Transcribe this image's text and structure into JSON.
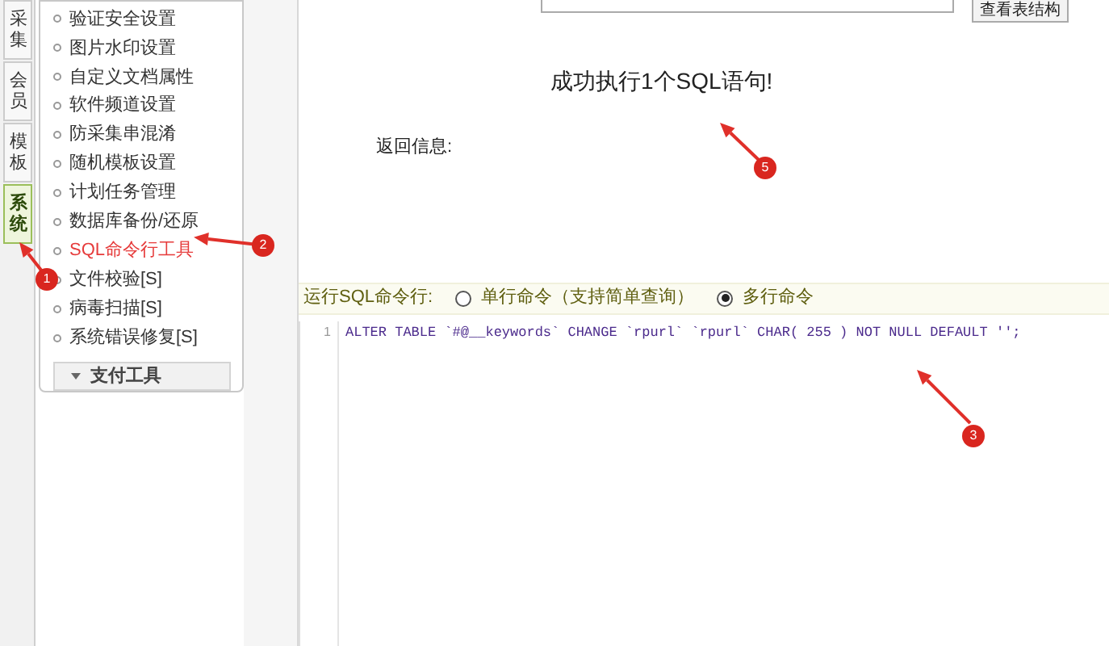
{
  "side_tabs": [
    {
      "label": "采集",
      "selected": false
    },
    {
      "label": "会员",
      "selected": false
    },
    {
      "label": "模板",
      "selected": false
    },
    {
      "label": "系统",
      "selected": true
    }
  ],
  "menu": {
    "items": [
      {
        "label": "验证安全设置",
        "selected": false
      },
      {
        "label": "图片水印设置",
        "selected": false
      },
      {
        "label": "自定义文档属性",
        "selected": false
      },
      {
        "label": "软件频道设置",
        "selected": false
      },
      {
        "label": "防采集串混淆",
        "selected": false
      },
      {
        "label": "随机模板设置",
        "selected": false
      },
      {
        "label": "计划任务管理",
        "selected": false
      },
      {
        "label": "数据库备份/还原",
        "selected": false
      },
      {
        "label": "SQL命令行工具",
        "selected": true
      },
      {
        "label": "文件校验[S]",
        "selected": false
      },
      {
        "label": "病毒扫描[S]",
        "selected": false
      },
      {
        "label": "系统错误修复[S]",
        "selected": false
      }
    ],
    "group_button": "支付工具"
  },
  "toolbar": {
    "button": "查看表结构"
  },
  "result": {
    "message": "成功执行1个SQL语句!",
    "label": "返回信息:"
  },
  "run_line": {
    "label": "运行SQL命令行:",
    "options": [
      {
        "label": "单行命令（支持简单查询）",
        "selected": false
      },
      {
        "label": "多行命令",
        "selected": true
      }
    ]
  },
  "editor": {
    "lines": [
      {
        "number": "1",
        "code": "ALTER TABLE `#@__keywords` CHANGE `rpurl` `rpurl` CHAR( 255 ) NOT NULL DEFAULT '';"
      }
    ]
  },
  "annotations": [
    {
      "number": "1"
    },
    {
      "number": "2"
    },
    {
      "number": "3"
    },
    {
      "number": "5"
    }
  ]
}
